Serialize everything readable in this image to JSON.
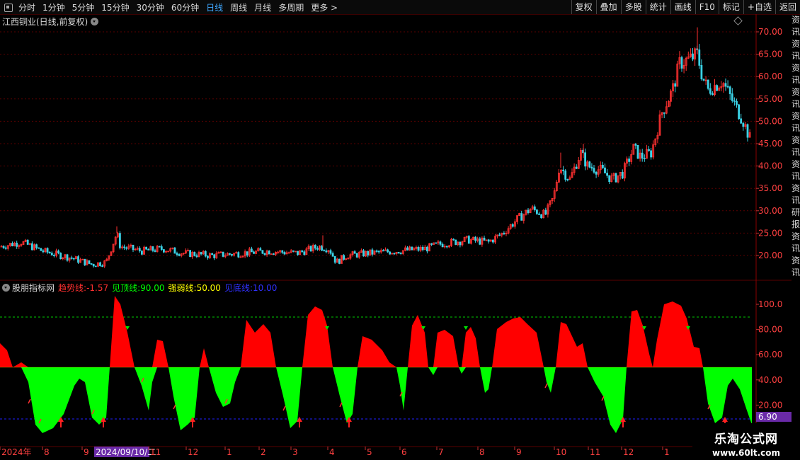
{
  "toolbar": {
    "periods": [
      "分时",
      "1分钟",
      "5分钟",
      "15分钟",
      "30分钟",
      "60分钟",
      "日线",
      "周线",
      "月线",
      "多周期",
      "更多 >"
    ],
    "active_index": 6,
    "right_buttons": [
      "复权",
      "叠加",
      "多股",
      "统计",
      "画线",
      "F10",
      "标记",
      "+自选",
      "返回"
    ]
  },
  "main_chart": {
    "title": "江西铜业(日线,前复权)",
    "price_labels": [
      "70.00",
      "65.00",
      "60.00",
      "55.00",
      "50.00",
      "45.00",
      "40.00",
      "35.00",
      "30.00",
      "25.00",
      "20.00"
    ]
  },
  "indicator": {
    "name": "股朋指标网",
    "trend_label": "趋势线:",
    "trend_value": "-1.57",
    "top_label": "见顶线:",
    "top_value": "90.00",
    "mid_label": "强弱线:",
    "mid_value": "50.00",
    "bottom_label": "见底线:",
    "bottom_value": "10.00",
    "scale_labels": [
      "100.0",
      "80.00",
      "60.00",
      "40.00",
      "20.00"
    ],
    "current_tag": "6.90"
  },
  "date_axis": {
    "labels": [
      "2024年",
      "8",
      "9",
      "2024/09/10/二",
      "11",
      "12",
      "1",
      "2",
      "3",
      "4",
      "5",
      "6",
      "7",
      "8",
      "9",
      "10",
      "11",
      "12",
      "1"
    ]
  },
  "sidebar_text": "资讯资讯资讯资讯资讯资讯资讯资讯研报资讯资讯公告资讯资讯",
  "logo": {
    "name": "乐淘公式网",
    "url": "www.60lt.com"
  },
  "colors": {
    "up": "#ff3030",
    "down": "#3ad2e6",
    "area_up": "#ff0000",
    "area_down": "#00ff00",
    "grid": "#5a0000",
    "top_line": "#00cc00",
    "bottom_line": "#2020ff"
  }
}
